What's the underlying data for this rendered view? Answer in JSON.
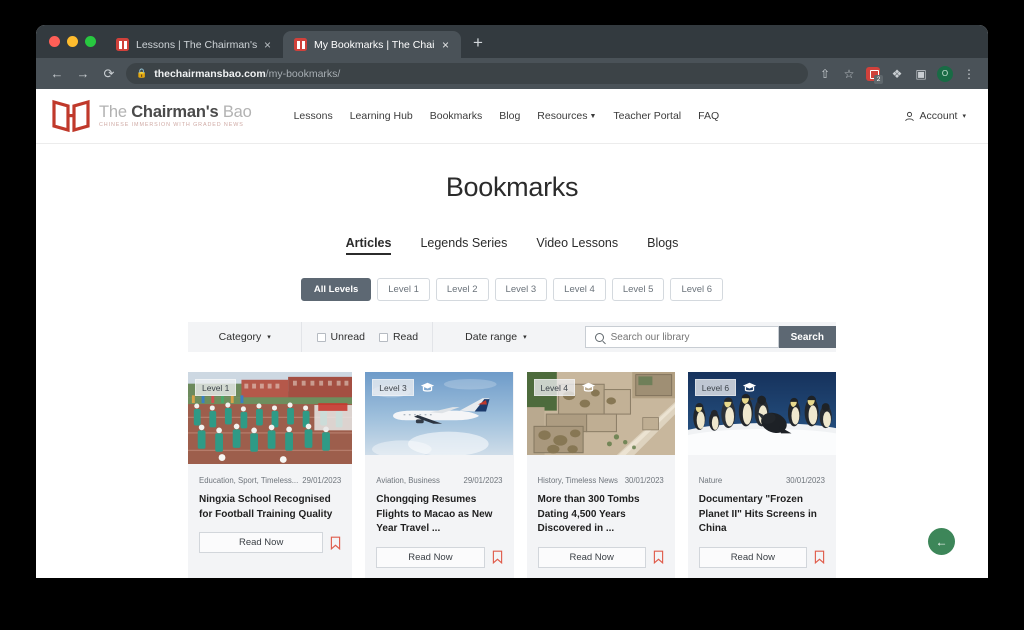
{
  "browser": {
    "tabs": [
      {
        "title": "Lessons | The Chairman's Bao",
        "active": false,
        "favicon": "chairmans-bao-favicon",
        "close": "×"
      },
      {
        "title": "My Bookmarks | The Chairman",
        "active": true,
        "favicon": "chairmans-bao-favicon",
        "close": "×"
      }
    ],
    "new_tab_label": "+",
    "nav": {
      "back": "←",
      "forward": "→",
      "reload": "⟳"
    },
    "omnibox": {
      "lock": "🔒",
      "host": "thechairmansbao.com",
      "path": "/my-bookmarks/"
    },
    "toolbar_icons": {
      "share": "⇧",
      "bookmark_star": "☆",
      "extension_badge_count": "2",
      "puzzle": "❖",
      "sidepanel": "▣",
      "profile_initial": "O",
      "menu": "⋮"
    }
  },
  "site": {
    "logo": {
      "line1_light": "The ",
      "line1_bold": "Chairman's",
      "line1_light2": " Bao",
      "tagline": "CHINESE IMMERSION WITH GRADED NEWS",
      "color": "#c0392b"
    },
    "nav": [
      {
        "label": "Lessons",
        "caret": false
      },
      {
        "label": "Learning Hub",
        "caret": false
      },
      {
        "label": "Bookmarks",
        "caret": false
      },
      {
        "label": "Blog",
        "caret": false
      },
      {
        "label": "Resources",
        "caret": true
      },
      {
        "label": "Teacher Portal",
        "caret": false
      },
      {
        "label": "FAQ",
        "caret": false
      }
    ],
    "account": {
      "label": "Account",
      "caret": "▾",
      "icon": "person-icon"
    },
    "page_title": "Bookmarks",
    "content_tabs": [
      {
        "label": "Articles",
        "selected": true
      },
      {
        "label": "Legends Series",
        "selected": false
      },
      {
        "label": "Video Lessons",
        "selected": false
      },
      {
        "label": "Blogs",
        "selected": false
      }
    ],
    "levels": [
      {
        "label": "All Levels",
        "active": true
      },
      {
        "label": "Level 1",
        "active": false
      },
      {
        "label": "Level 2",
        "active": false
      },
      {
        "label": "Level 3",
        "active": false
      },
      {
        "label": "Level 4",
        "active": false
      },
      {
        "label": "Level 5",
        "active": false
      },
      {
        "label": "Level 6",
        "active": false
      }
    ],
    "filters": {
      "category_label": "Category",
      "category_caret": "▾",
      "unread_label": "Unread",
      "unread_checked": false,
      "read_label": "Read",
      "read_checked": false,
      "date_range_label": "Date range",
      "date_caret": "▾",
      "search_placeholder": "Search our library",
      "search_value": "",
      "search_button": "Search"
    },
    "cards": [
      {
        "level": "Level 1",
        "categories": "Education, Sport, Timeless...",
        "date": "29/01/2023",
        "title": "Ningxia School Recognised for Football Training Quality",
        "read_now": "Read Now",
        "image": "students-football-training-track",
        "has_video_badge": false
      },
      {
        "level": "Level 3",
        "categories": "Aviation, Business",
        "date": "29/01/2023",
        "title": "Chongqing Resumes Flights to Macao as New Year Travel ...",
        "read_now": "Read Now",
        "image": "airplane-in-blue-sky",
        "has_video_badge": true
      },
      {
        "level": "Level 4",
        "categories": "History, Timeless News",
        "date": "30/01/2023",
        "title": "More than 300 Tombs Dating 4,500 Years Discovered in ...",
        "read_now": "Read Now",
        "image": "archaeological-excavation-aerial",
        "has_video_badge": true
      },
      {
        "level": "Level 6",
        "categories": "Nature",
        "date": "30/01/2023",
        "title": "Documentary \"Frozen Planet II\" Hits Screens in China",
        "read_now": "Read Now",
        "image": "emperor-penguins-on-ice",
        "has_video_badge": true
      }
    ],
    "fab": {
      "icon": "←",
      "color": "#3d8659"
    }
  }
}
